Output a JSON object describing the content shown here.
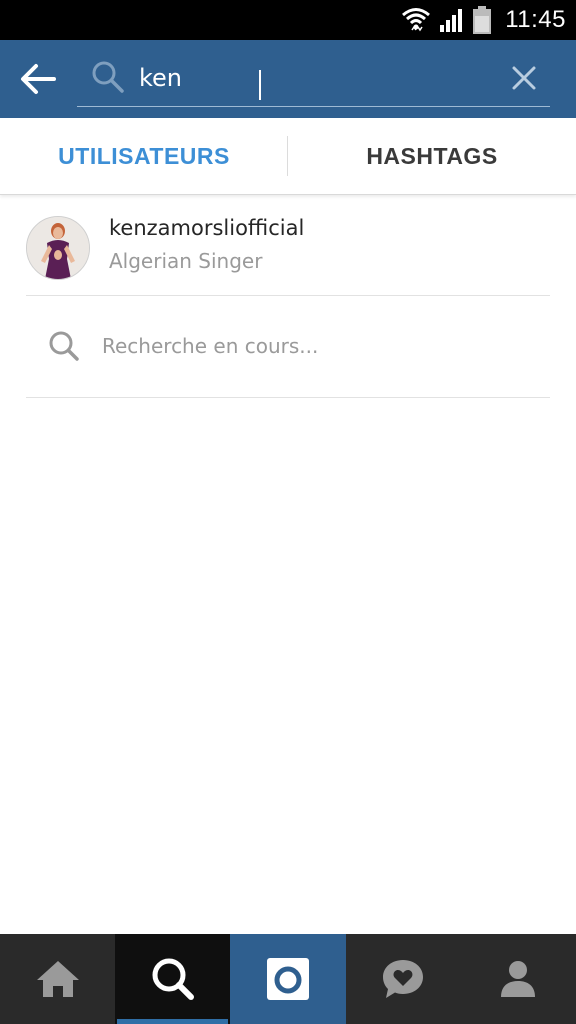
{
  "status_bar": {
    "time": "11:45"
  },
  "search": {
    "query": "ken"
  },
  "tabs": [
    {
      "label": "UTILISATEURS",
      "active": true
    },
    {
      "label": "HASHTAGS",
      "active": false
    }
  ],
  "results": [
    {
      "username": "kenzamorsliofficial",
      "full_name": "Algerian Singer"
    }
  ],
  "searching_label": "Recherche en cours...",
  "bottom_nav": [
    "home-icon",
    "search-icon",
    "camera-icon",
    "activity-icon",
    "profile-icon"
  ],
  "colors": {
    "header": "#2f5f8f",
    "active_tab": "#3d8fd6",
    "nav_bg": "#2a2a2a"
  }
}
